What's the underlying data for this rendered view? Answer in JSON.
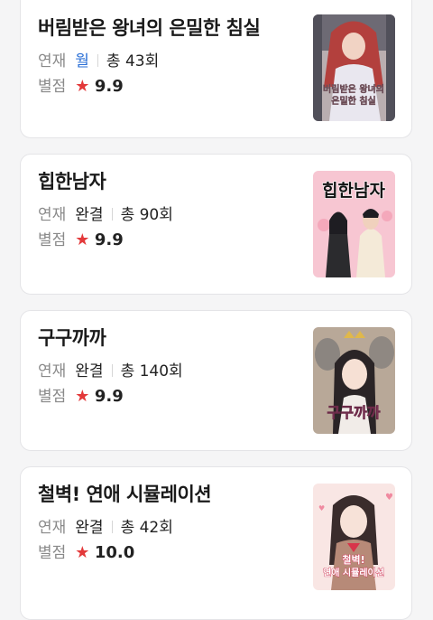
{
  "labels": {
    "serial": "연재",
    "rating": "별점",
    "star": "★"
  },
  "items": [
    {
      "title": "버림받은 왕녀의 은밀한 침실",
      "day": "월",
      "episodes": "총 43회",
      "rating": "9.9",
      "cover_text": [
        "버림받은 왕녀의",
        "은밀한 침실"
      ]
    },
    {
      "title": "힙한남자",
      "day": "완결",
      "episodes": "총 90회",
      "rating": "9.9",
      "cover_text": [
        "힙한남자"
      ]
    },
    {
      "title": "구구까까",
      "day": "완결",
      "episodes": "총 140회",
      "rating": "9.9",
      "cover_text": [
        "구구까까"
      ]
    },
    {
      "title": "철벽! 연애 시뮬레이션",
      "day": "완결",
      "episodes": "총 42회",
      "rating": "10.0",
      "cover_text": [
        "철벽!",
        "연애 시뮬레이션"
      ]
    }
  ],
  "colors": {
    "star": "#e3393a",
    "day_active": "#2a6fd6"
  }
}
